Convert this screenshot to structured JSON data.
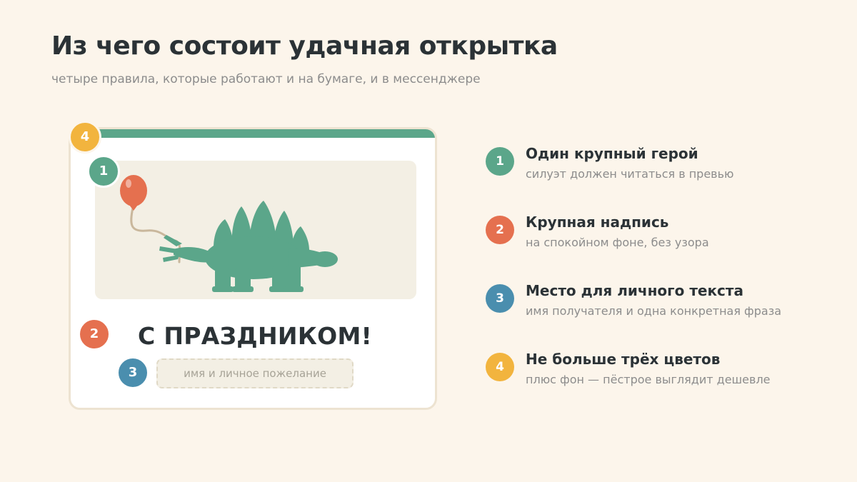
{
  "header": {
    "title": "Из чего состоит удачная открытка",
    "subtitle": "четыре правила, которые работают и на бумаге, и в мессенджере"
  },
  "card": {
    "headline": "С ПРАЗДНИКОМ!",
    "wish_placeholder": "имя и личное пожелание",
    "badges": {
      "hero": "1",
      "headline": "2",
      "wish": "3",
      "colors": "4"
    },
    "illustration": [
      "stegosaurus-icon",
      "balloon-icon"
    ]
  },
  "colors": {
    "background": "#fcf5eb",
    "green": "#5ba68a",
    "coral": "#e5704f",
    "blue": "#4a8eae",
    "gold": "#f2b43e",
    "text": "#2b3236",
    "muted": "#8c8c8c"
  },
  "rules": [
    {
      "number": "1",
      "title": "Один крупный герой",
      "description": "силуэт должен читаться в превью"
    },
    {
      "number": "2",
      "title": "Крупная надпись",
      "description": "на спокойном фоне, без узора"
    },
    {
      "number": "3",
      "title": "Место для личного текста",
      "description": "имя получателя и одна конкретная фраза"
    },
    {
      "number": "4",
      "title": "Не больше трёх цветов",
      "description": "плюс фон — пёстрое выглядит дешевле"
    }
  ]
}
